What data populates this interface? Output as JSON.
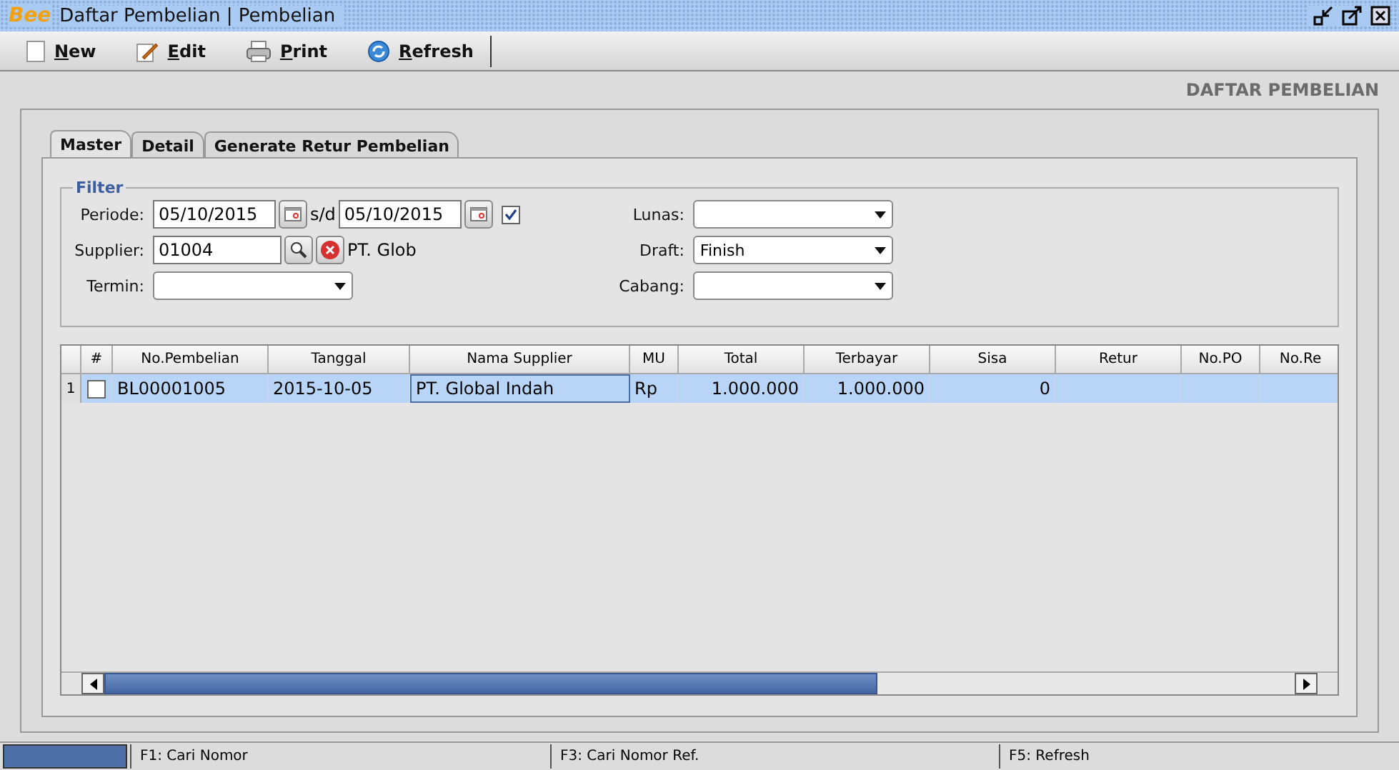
{
  "window": {
    "title": "Daftar Pembelian | Pembelian",
    "logo": "Bee"
  },
  "toolbar": [
    {
      "label": "New",
      "kind": "new"
    },
    {
      "label": "Edit",
      "kind": "edit"
    },
    {
      "label": "Print",
      "kind": "print"
    },
    {
      "label": "Refresh",
      "kind": "refresh"
    }
  ],
  "page_title": "DAFTAR PEMBELIAN",
  "tabs": [
    {
      "label": "Master",
      "selected": true
    },
    {
      "label": "Detail",
      "selected": false
    },
    {
      "label": "Generate Retur Pembelian",
      "selected": false
    }
  ],
  "filter": {
    "title": "Filter",
    "periode": {
      "label": "Periode:",
      "from": "05/10/2015",
      "separator": "s/d",
      "to": "05/10/2015",
      "checked": true
    },
    "supplier": {
      "label": "Supplier:",
      "value": "01004",
      "name": "PT. Glob"
    },
    "termin": {
      "label": "Termin:"
    },
    "lunas": {
      "label": "Lunas:"
    },
    "draft": {
      "label": "Draft:",
      "value": "Finish"
    },
    "cabang": {
      "label": "Cabang:"
    }
  },
  "table": {
    "columns": [
      "#",
      "No.Pembelian",
      "Tanggal",
      "Nama Supplier",
      "MU",
      "Total",
      "Terbayar",
      "Sisa",
      "Retur",
      "No.PO",
      "No.Re"
    ],
    "rows": [
      {
        "number": "1",
        "checked": false,
        "selected": true,
        "cells": [
          "",
          "BL00001005",
          "2015-10-05",
          "PT. Global Indah",
          "Rp",
          "1.000.000",
          "1.000.000",
          "0",
          "",
          "",
          ""
        ]
      }
    ]
  },
  "status_bar": [
    "F1: Cari Nomor",
    "F3: Cari Nomor Ref.",
    "F5: Refresh"
  ]
}
